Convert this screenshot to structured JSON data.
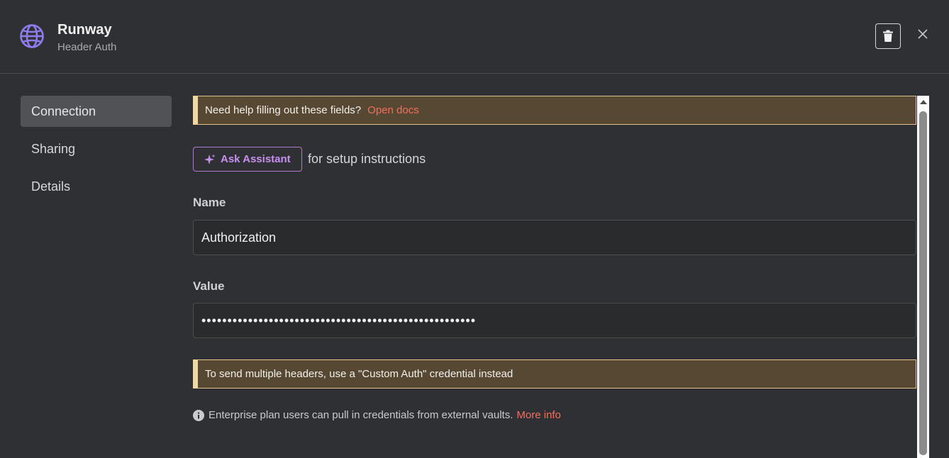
{
  "header": {
    "title": "Runway",
    "subtitle": "Header Auth",
    "icon": "globe-icon"
  },
  "sidebar": {
    "items": [
      {
        "label": "Connection",
        "active": true
      },
      {
        "label": "Sharing",
        "active": false
      },
      {
        "label": "Details",
        "active": false
      }
    ]
  },
  "help_callout": {
    "text": "Need help filling out these fields?",
    "link": "Open docs"
  },
  "assistant": {
    "button_label": "Ask Assistant",
    "after_text": "for setup instructions"
  },
  "fields": {
    "name_label": "Name",
    "name_value": "Authorization",
    "value_label": "Value",
    "value_masked": "•••••••••••••••••••••••••••••••••••••••••••••••••••••"
  },
  "warning_callout": {
    "text": "To send multiple headers, use a \"Custom Auth\" credential instead"
  },
  "info": {
    "text": "Enterprise plan users can pull in credentials from external vaults.",
    "link": "More info"
  },
  "colors": {
    "background": "#2f3033",
    "accent_link": "#f07060",
    "callout_bg": "#564833",
    "assistant_purple": "#c690f0",
    "globe_purple": "#8f7cf0"
  }
}
